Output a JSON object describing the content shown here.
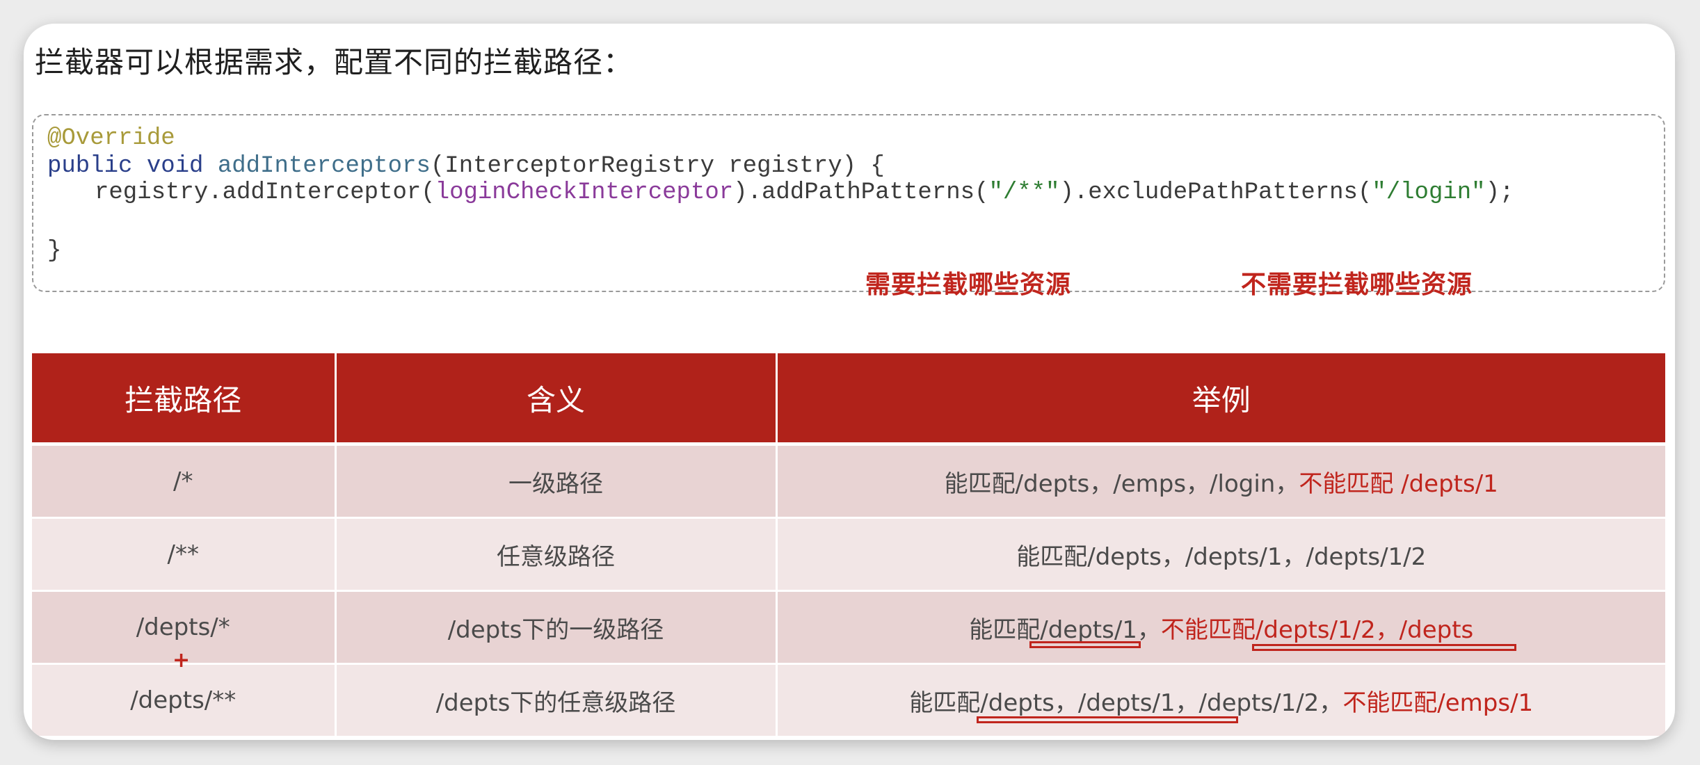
{
  "heading": "拦截器可以根据需求，配置不同的拦截路径：",
  "code": {
    "line1": "@Override",
    "line2_kw": "public void",
    "line2_fn": "addInterceptors",
    "line2_rest": "(InterceptorRegistry registry) {",
    "line3_a": "registry.addInterceptor(",
    "line3_var": "loginCheckInterceptor",
    "line3_b": ").addPathPatterns(",
    "line3_s1": "\"/**\"",
    "line3_c": ").excludePathPatterns(",
    "line3_s2": "\"/login\"",
    "line3_d": ");",
    "line4": "}"
  },
  "notes": {
    "include": "需要拦截哪些资源",
    "exclude": "不需要拦截哪些资源"
  },
  "table": {
    "headers": [
      "拦截路径",
      "含义",
      "举例"
    ],
    "rows": [
      {
        "path": "/*",
        "meaning": "一级路径",
        "ex_normal": "能匹配/depts，/emps，/login，",
        "ex_red": "不能匹配 /depts/1"
      },
      {
        "path": "/**",
        "meaning": "任意级路径",
        "ex_normal": "能匹配/depts，/depts/1，/depts/1/2",
        "ex_red": ""
      },
      {
        "path": "/depts/*",
        "meaning": "/depts下的一级路径",
        "ex_normal": "能匹配/depts/1，",
        "ex_red": "不能匹配/depts/1/2，/depts"
      },
      {
        "path": "/depts/**",
        "meaning": "/depts下的任意级路径",
        "ex_normal": "能匹配/depts，/depts/1，/depts/1/2，",
        "ex_red": "不能匹配/emps/1"
      }
    ]
  },
  "colors": {
    "header_bg": "#b0221a",
    "accent_red": "#c0251d",
    "row_odd": "#e8d3d3",
    "row_even": "#f2e6e6"
  }
}
